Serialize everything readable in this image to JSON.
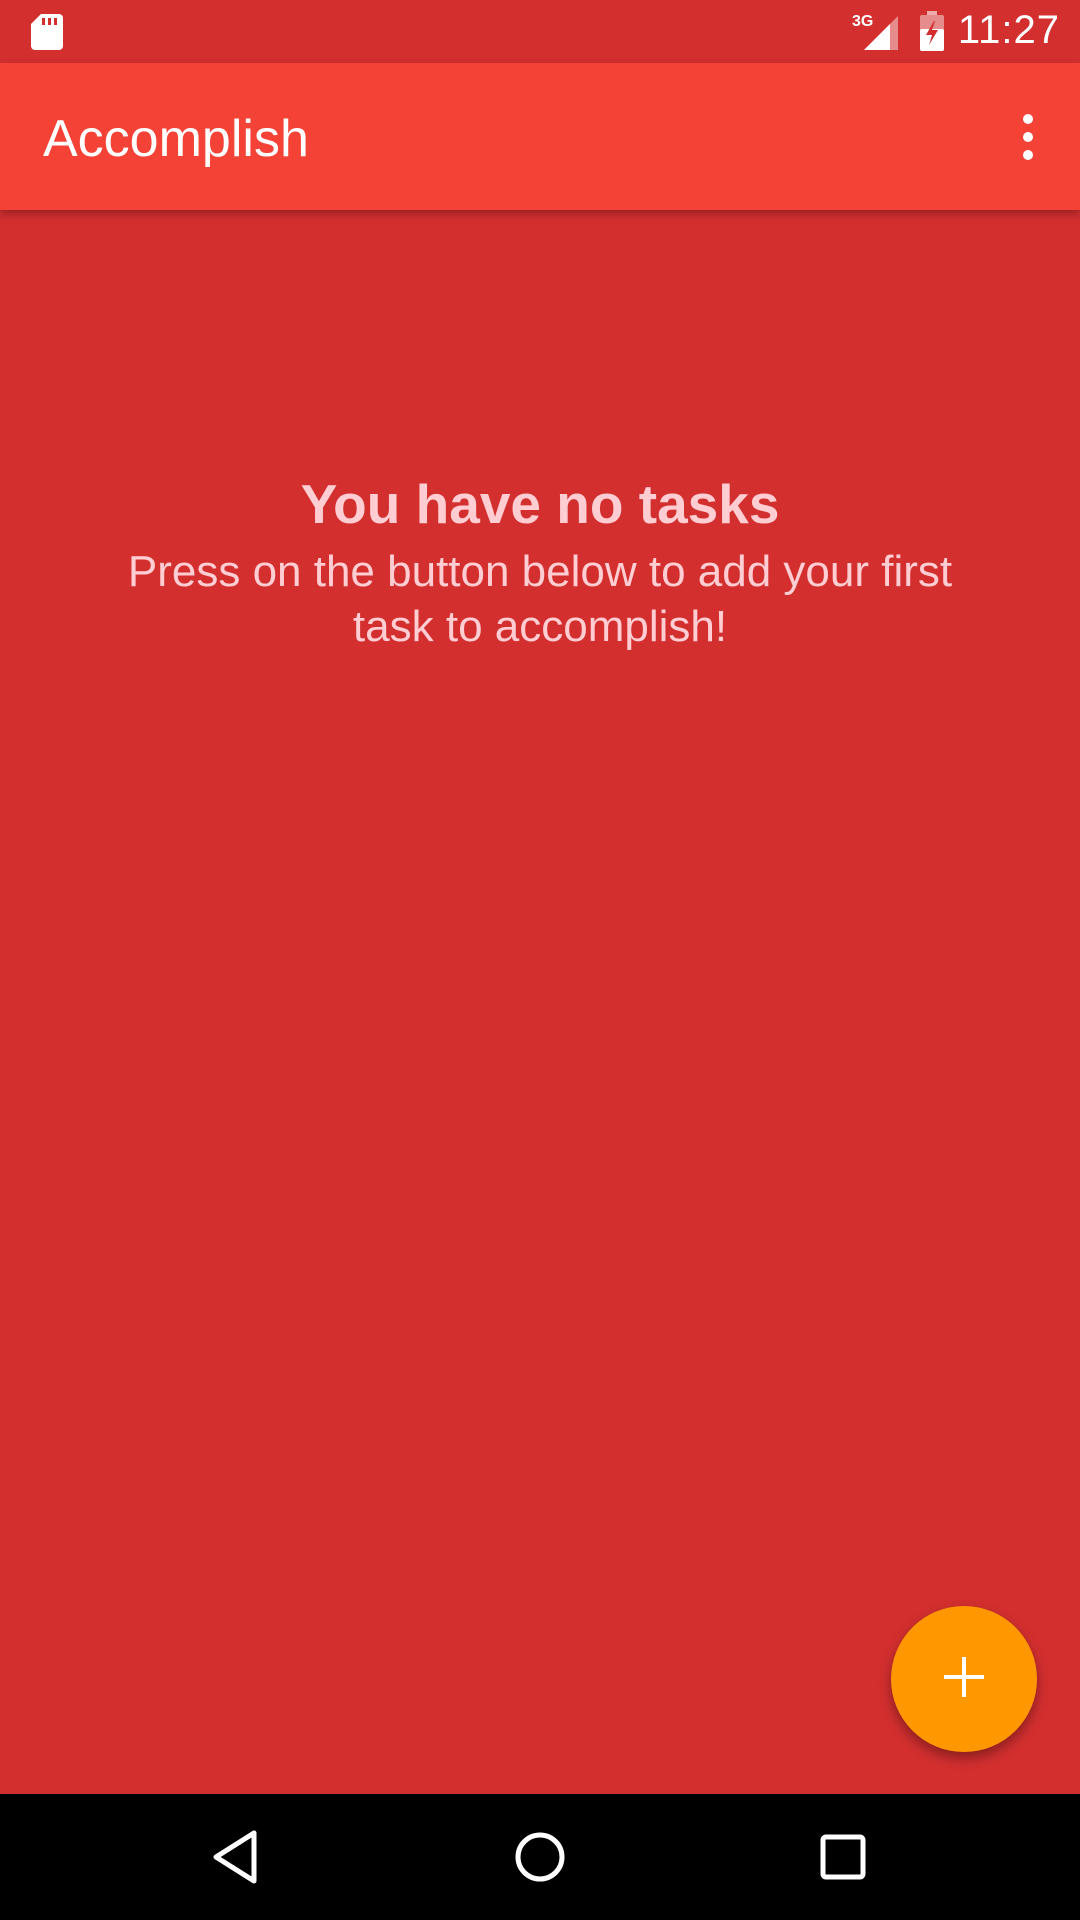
{
  "status_bar": {
    "network_label": "3G",
    "time": "11:27",
    "icons": [
      "sd-card-icon",
      "signal-icon",
      "battery-charging-icon"
    ]
  },
  "app_bar": {
    "title": "Accomplish",
    "menu_icon": "overflow-menu-icon"
  },
  "empty_state": {
    "title": "You have no tasks",
    "subtitle": "Press on the button below to add your first task to accomplish!"
  },
  "fab": {
    "icon": "plus-icon"
  },
  "nav_bar": {
    "icons": [
      "back-icon",
      "home-icon",
      "recents-icon"
    ]
  },
  "colors": {
    "primary": "#f44336",
    "primary_dark": "#d32f2f",
    "accent": "#ff9800",
    "empty_text": "#ffcdd2"
  }
}
